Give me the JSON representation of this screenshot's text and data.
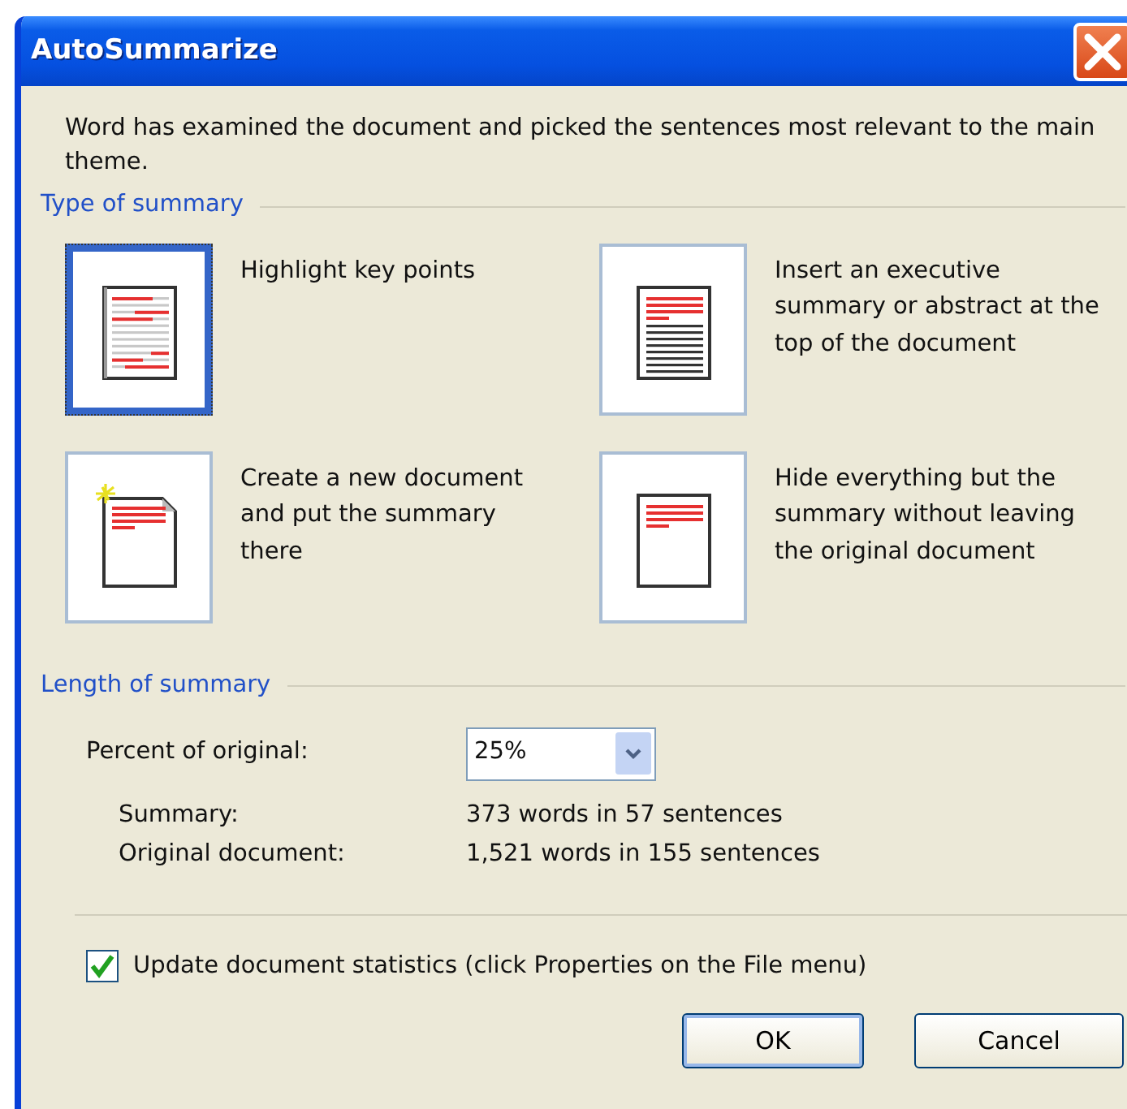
{
  "window": {
    "title": "AutoSummarize"
  },
  "intro": "Word has examined the document and picked the sentences most relevant to the main theme.",
  "type_group": {
    "title": "Type of summary",
    "options": [
      {
        "kind": "highlight",
        "label": "Highlight key points",
        "selected": true
      },
      {
        "kind": "executive",
        "label": "Insert an executive summary or abstract at the top of the document",
        "selected": false
      },
      {
        "kind": "new",
        "label": "Create a new document and put the summary there",
        "selected": false
      },
      {
        "kind": "hide",
        "label": "Hide everything but the summary without leaving the original document",
        "selected": false
      }
    ]
  },
  "length_group": {
    "title": "Length of summary",
    "percent_label": "Percent of original:",
    "percent_value": "25%",
    "stats": [
      {
        "label": "Summary:",
        "value": "373 words in 57 sentences"
      },
      {
        "label": "Original document:",
        "value": "1,521 words in 155 sentences"
      }
    ]
  },
  "update_stats": {
    "label": "Update document statistics (click Properties on the File menu)",
    "checked": true
  },
  "buttons": [
    {
      "label": "OK",
      "default": true
    },
    {
      "label": "Cancel",
      "default": false
    }
  ]
}
